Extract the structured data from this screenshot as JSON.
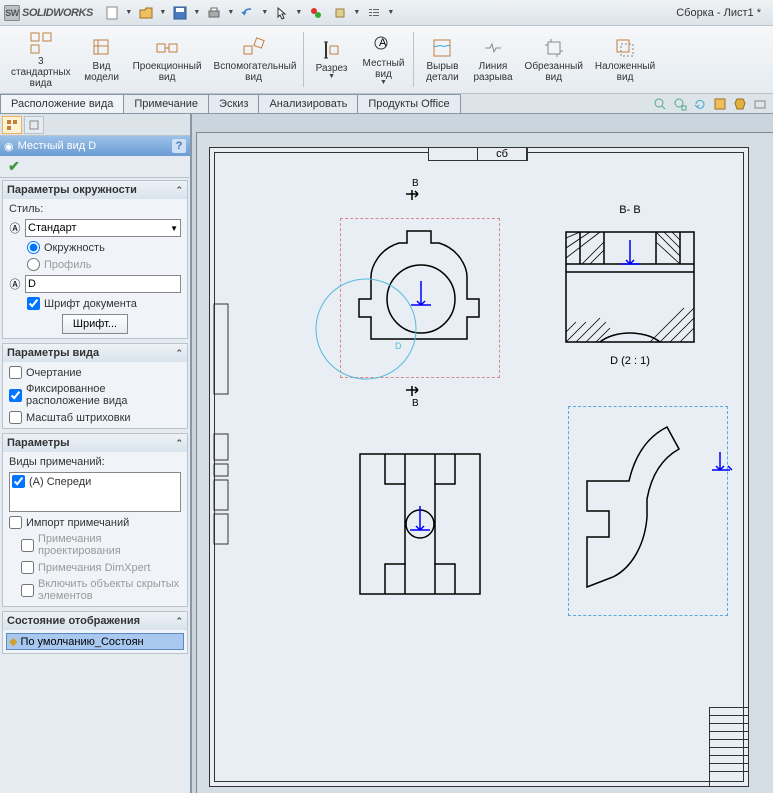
{
  "app": {
    "name": "SOLIDWORKS",
    "doc_title": "Сборка - Лист1 *"
  },
  "qat": {
    "new": "new",
    "open": "open",
    "save": "save",
    "print": "print",
    "undo": "undo",
    "select": "select",
    "rebuild": "rebuild",
    "options": "options",
    "props": "props"
  },
  "ribbon": [
    {
      "label": "3\nстандартных\nвида",
      "drop": false
    },
    {
      "label": "Вид\nмодели",
      "drop": false
    },
    {
      "label": "Проекционный\nвид",
      "drop": false
    },
    {
      "label": "Вспомогательный\nвид",
      "drop": false
    },
    {
      "label": "Разрез",
      "drop": true
    },
    {
      "label": "Местный\nвид",
      "drop": true
    },
    {
      "label": "Вырыв\nдетали",
      "drop": false
    },
    {
      "label": "Линия\nразрыва",
      "drop": false
    },
    {
      "label": "Обрезанный\nвид",
      "drop": false
    },
    {
      "label": "Наложенный\nвид",
      "drop": false
    }
  ],
  "cmd_tabs": [
    "Расположение вида",
    "Примечание",
    "Эскиз",
    "Анализировать",
    "Продукты Office"
  ],
  "cmd_active": 0,
  "panel": {
    "title": "Местный вид D",
    "sec_circle": {
      "hdr": "Параметры окружности",
      "style_label": "Стиль:",
      "style_value": "Стандарт",
      "opt_circle": "Окружность",
      "opt_profile": "Профиль",
      "name_value": "D",
      "doc_font": "Шрифт документа",
      "font_btn": "Шрифт..."
    },
    "sec_view": {
      "hdr": "Параметры вида",
      "outline": "Очертание",
      "fixed": "Фиксированное расположение вида",
      "hatch": "Масштаб штриховки"
    },
    "sec_params": {
      "hdr": "Параметры",
      "annot_types": "Виды примечаний:",
      "front": "(A) Спереди",
      "import": "Импорт примечаний",
      "design": "Примечания проектирования",
      "dimx": "Примечания DimXpert",
      "hidden": "Включить объекты скрытых элементов"
    },
    "sec_display": {
      "hdr": "Состояние отображения",
      "state": "По умолчанию_Состоян"
    }
  },
  "drawing": {
    "section_label_b1": "B",
    "section_label_b2": "B",
    "section_title": "B- B",
    "detail_title": "D  (2 : 1)",
    "detail_letter": "D",
    "sheet_cell": "сб"
  }
}
